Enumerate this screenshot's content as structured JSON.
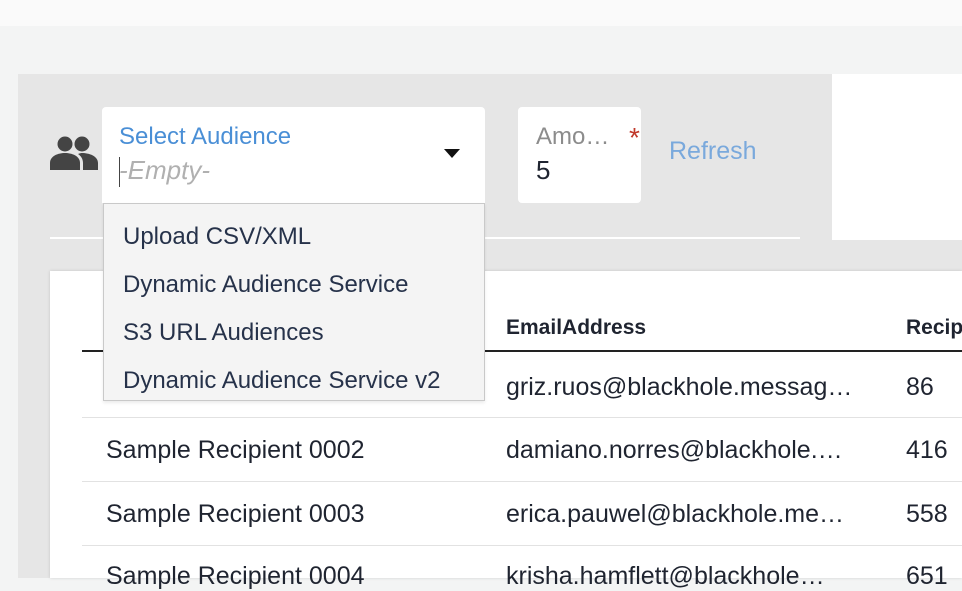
{
  "audience_select": {
    "label": "Select Audience",
    "value_placeholder": "-Empty-",
    "options": [
      "Upload CSV/XML",
      "Dynamic Audience Service",
      "S3 URL Audiences",
      "Dynamic Audience Service v2"
    ]
  },
  "amount_field": {
    "label": "Amo…",
    "value": "5",
    "required_mark": "*"
  },
  "refresh_label": "Refresh",
  "table": {
    "columns": [
      "EmailAddress",
      "Recip"
    ],
    "rows": [
      {
        "name": "",
        "email": "griz.ruos@blackhole.messag…",
        "recip": "86"
      },
      {
        "name": "Sample Recipient 0002",
        "email": "damiano.norres@blackhole.…",
        "recip": "416"
      },
      {
        "name": "Sample Recipient 0003",
        "email": "erica.pauwel@blackhole.me…",
        "recip": "558"
      },
      {
        "name": "Sample Recipient 0004",
        "email": "krisha.hamflett@blackhole…",
        "recip": "651"
      }
    ]
  },
  "icons": {
    "audience": "people-icon",
    "dropdown": "chevron-down-icon"
  },
  "colors": {
    "accent": "#4a8fd6",
    "link": "#7aa9dc",
    "required": "#c0392b"
  }
}
